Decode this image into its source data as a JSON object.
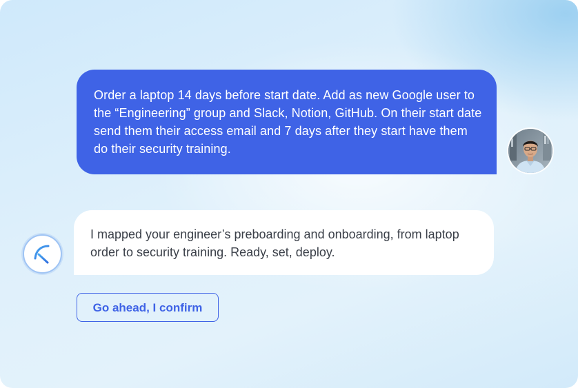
{
  "chat": {
    "user_message": "Order a laptop 14 days before start date. Add as new Google user to the “Engineering” group and Slack, Notion, GitHub. On their start date send them their access email and 7 days after they start have them do their security training.",
    "bot_message": "I mapped your engineer’s preboarding and onboarding, from laptop order to security training. Ready, set, deploy.",
    "confirm_button_label": "Go ahead, I confirm"
  },
  "icons": {
    "user_avatar": "user-avatar-photo",
    "bot_logo": "assistant-logo-icon"
  },
  "colors": {
    "accent": "#3f63e6",
    "bot_bubble": "#ffffff",
    "bot_text": "#3b4049",
    "background": "#d9eefb"
  }
}
